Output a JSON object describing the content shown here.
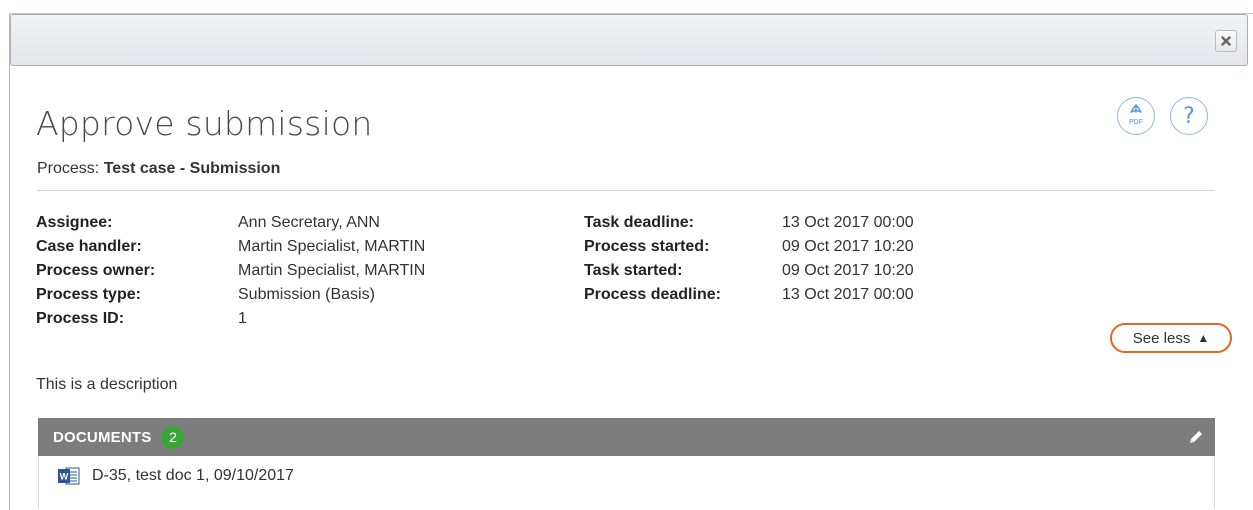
{
  "dialog": {
    "close_icon": "close-icon"
  },
  "task": {
    "title": "Approve submission",
    "process_label": "Process:",
    "process_name": "Test case - Submission"
  },
  "actions": {
    "pdf_icon": "pdf-icon",
    "pdf_label": "PDF",
    "help_icon": "help-icon",
    "help_label": "?"
  },
  "details_left": [
    {
      "label": "Assignee:",
      "value": "Ann Secretary, ANN"
    },
    {
      "label": "Case handler:",
      "value": "Martin Specialist, MARTIN"
    },
    {
      "label": "Process owner:",
      "value": "Martin Specialist, MARTIN"
    },
    {
      "label": "Process type:",
      "value": "Submission (Basis)"
    },
    {
      "label": "Process ID:",
      "value": "1"
    }
  ],
  "details_right": [
    {
      "label": "Task deadline:",
      "value": "13 Oct 2017 00:00"
    },
    {
      "label": "Process started:",
      "value": "09 Oct 2017 10:20"
    },
    {
      "label": "Task started:",
      "value": "09 Oct 2017 10:20"
    },
    {
      "label": "Process deadline:",
      "value": "13 Oct 2017 00:00"
    }
  ],
  "see_less": {
    "label": "See less",
    "arrow": "▲",
    "highlight_color": "#e06a1e"
  },
  "description": "This is a description",
  "documents": {
    "header": "DOCUMENTS",
    "count": "2",
    "header_color": "#7d7d7d",
    "badge_color": "#3aa63a",
    "edit_icon": "pencil-icon",
    "items": [
      {
        "icon": "word-doc-icon",
        "label": "D-35, test doc 1, 09/10/2017"
      }
    ]
  }
}
